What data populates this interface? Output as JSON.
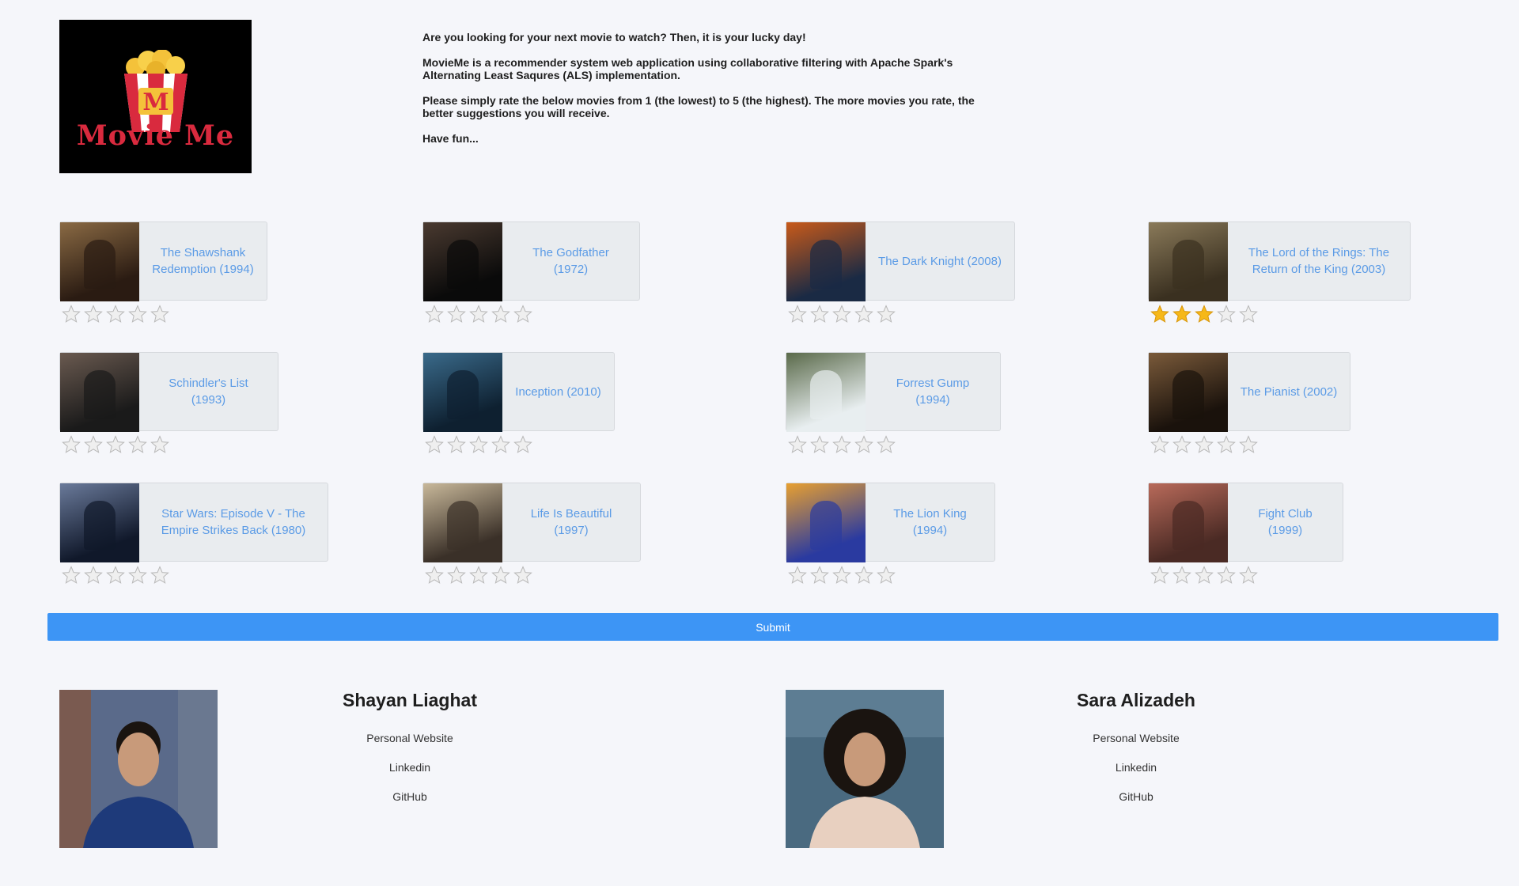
{
  "logo": {
    "text": "Movie Me",
    "letter": "M"
  },
  "intro": {
    "line1": "Are you looking for your next movie to watch? Then, it is your lucky day!",
    "line2": "MovieMe is a recommender system web application using collaborative filtering with Apache Spark's Alternating Least Saqures (ALS) implementation.",
    "line3": "Please simply rate the below movies from 1 (the lowest) to 5 (the highest). The more movies you rate, the better suggestions you will receive.",
    "line4": "Have fun..."
  },
  "movies": [
    {
      "title": "The Shawshank Redemption (1994)",
      "rating": 0,
      "poster_colors": [
        "#2a1b12",
        "#8a6a44"
      ]
    },
    {
      "title": "The Godfather (1972)",
      "rating": 0,
      "poster_colors": [
        "#0a0a0a",
        "#4a3a30"
      ]
    },
    {
      "title": "The Dark Knight (2008)",
      "rating": 0,
      "poster_colors": [
        "#1a2a44",
        "#c85a1a"
      ]
    },
    {
      "title": "The Lord of the Rings: The Return of the King (2003)",
      "rating": 3,
      "poster_colors": [
        "#3a3020",
        "#8a7a5a"
      ]
    },
    {
      "title": "Schindler's List (1993)",
      "rating": 0,
      "poster_colors": [
        "#1a1a1a",
        "#6a5a50"
      ]
    },
    {
      "title": "Inception (2010)",
      "rating": 0,
      "poster_colors": [
        "#0e2030",
        "#3a6a8a"
      ]
    },
    {
      "title": "Forrest Gump (1994)",
      "rating": 0,
      "poster_colors": [
        "#e8eef0",
        "#5a6a4a"
      ]
    },
    {
      "title": "The Pianist (2002)",
      "rating": 0,
      "poster_colors": [
        "#1a120c",
        "#7a5a3a"
      ]
    },
    {
      "title": "Star Wars: Episode V - The Empire Strikes Back (1980)",
      "rating": 0,
      "poster_colors": [
        "#10182a",
        "#6a7a9a"
      ]
    },
    {
      "title": "Life Is Beautiful (1997)",
      "rating": 0,
      "poster_colors": [
        "#3a3028",
        "#c8b89a"
      ]
    },
    {
      "title": "The Lion King (1994)",
      "rating": 0,
      "poster_colors": [
        "#2a3aa0",
        "#e8a030"
      ]
    },
    {
      "title": "Fight Club (1999)",
      "rating": 0,
      "poster_colors": [
        "#4a2a24",
        "#b86a5a"
      ]
    }
  ],
  "submit_label": "Submit",
  "authors": [
    {
      "name": "Shayan Liaghat",
      "links": [
        "Personal Website",
        "Linkedin",
        "GitHub"
      ],
      "photo_colors": [
        "#5a6a8a",
        "#1e3a7a"
      ]
    },
    {
      "name": "Sara Alizadeh",
      "links": [
        "Personal Website",
        "Linkedin",
        "GitHub"
      ],
      "photo_colors": [
        "#4a6a80",
        "#1a1410"
      ]
    }
  ],
  "colors": {
    "accent": "#3d95f5",
    "link": "#5b9be6",
    "star_on": "#f6b819",
    "star_off": "#d6d6d6"
  }
}
